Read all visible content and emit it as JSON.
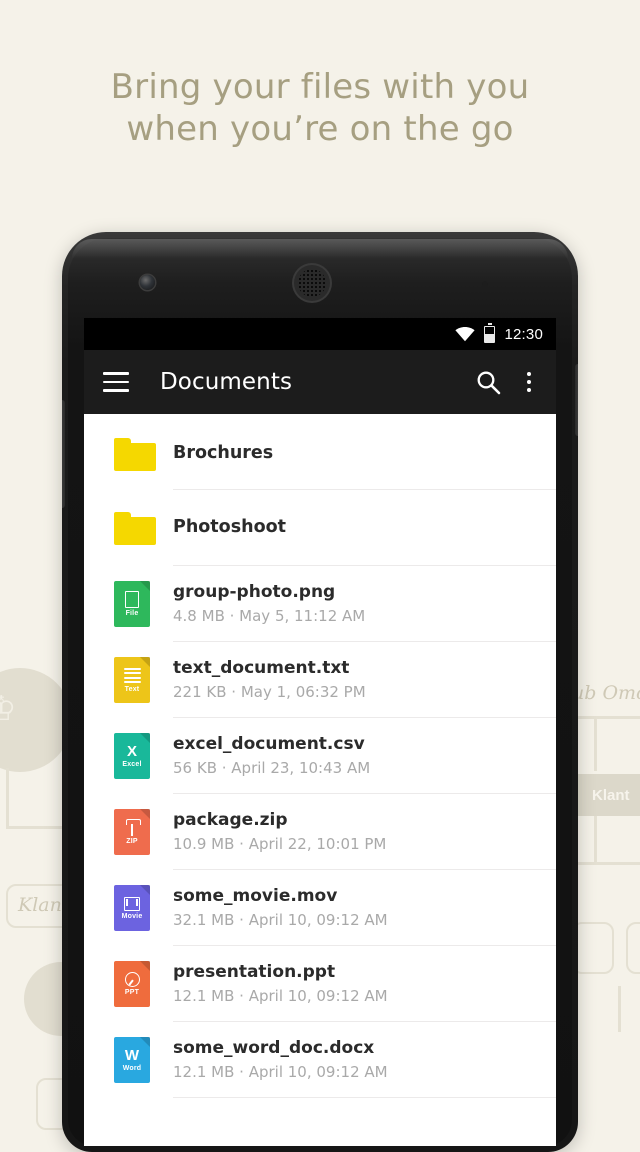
{
  "headline": {
    "line1": "Bring your files with you",
    "line2": "when you’re on the go",
    "color": "#a69f81"
  },
  "background": {
    "color": "#f5f2e9",
    "watermarks": [
      {
        "type": "label",
        "text": "Klant"
      },
      {
        "type": "label",
        "text": "Klant"
      },
      {
        "type": "script",
        "text": "Klant"
      },
      {
        "type": "script",
        "text": "ub Omo"
      }
    ]
  },
  "statusbar": {
    "time": "12:30",
    "wifi_icon": "wifi-icon",
    "battery_icon": "battery-icon",
    "battery_level": "50%",
    "background": "#000000"
  },
  "appbar": {
    "title": "Documents",
    "menu_icon": "hamburger-menu-icon",
    "search_icon": "search-icon",
    "overflow_icon": "overflow-menu-icon",
    "background": "#1c1c1c"
  },
  "filelist": {
    "rows": [
      {
        "name": "Brochures",
        "meta": "",
        "kind": "folder",
        "icon": "folder-icon",
        "icon_color": "#f5d800",
        "glyph": "",
        "badge": ""
      },
      {
        "name": "Photoshoot",
        "meta": "",
        "kind": "folder",
        "icon": "folder-icon",
        "icon_color": "#f5d800",
        "glyph": "",
        "badge": ""
      },
      {
        "name": "group-photo.png",
        "meta": "4.8 MB · May 5, 11:12 AM",
        "kind": "file",
        "icon": "file-png-icon",
        "icon_color": "#2eb85c",
        "glyph": "doc",
        "badge": "File"
      },
      {
        "name": "text_document.txt",
        "meta": "221 KB · May 1, 06:32 PM",
        "kind": "file",
        "icon": "file-txt-icon",
        "icon_color": "#edc519",
        "glyph": "lines",
        "badge": "Text"
      },
      {
        "name": "excel_document.csv",
        "meta": "56 KB · April 23, 10:43 AM",
        "kind": "file",
        "icon": "file-excel-icon",
        "icon_color": "#19b89a",
        "glyph": "X",
        "badge": "Excel"
      },
      {
        "name": "package.zip",
        "meta": "10.9 MB · April 22, 10:01 PM",
        "kind": "file",
        "icon": "file-zip-icon",
        "icon_color": "#ef6c4d",
        "glyph": "zip",
        "badge": "ZIP"
      },
      {
        "name": "some_movie.mov",
        "meta": "32.1 MB · April 10, 09:12 AM",
        "kind": "file",
        "icon": "file-movie-icon",
        "icon_color": "#6c63e0",
        "glyph": "film",
        "badge": "Movie"
      },
      {
        "name": "presentation.ppt",
        "meta": "12.1 MB · April 10, 09:12 AM",
        "kind": "file",
        "icon": "file-ppt-icon",
        "icon_color": "#ef6c3d",
        "glyph": "pie",
        "badge": "PPT"
      },
      {
        "name": "some_word_doc.docx",
        "meta": "12.1 MB · April 10, 09:12 AM",
        "kind": "file",
        "icon": "file-word-icon",
        "icon_color": "#29a8e0",
        "glyph": "W",
        "badge": "Word"
      }
    ]
  }
}
